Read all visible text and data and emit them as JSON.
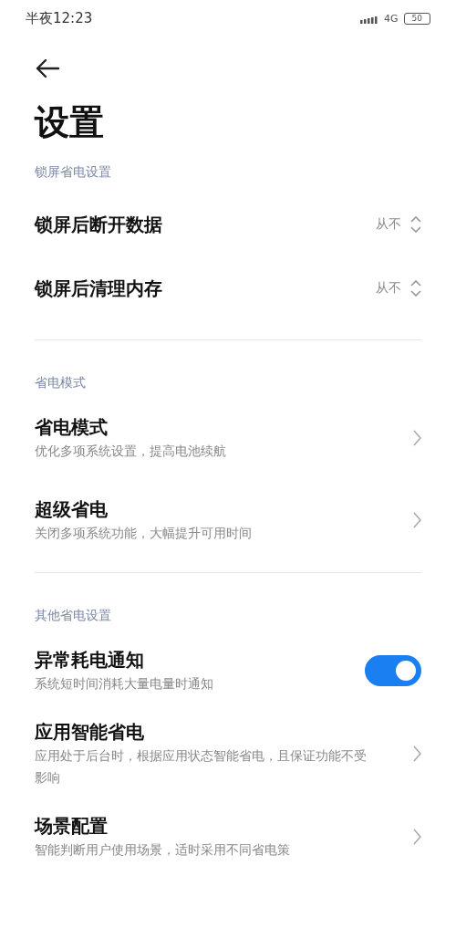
{
  "status_bar": {
    "time": "半夜12:23",
    "network": "4G",
    "battery": "50"
  },
  "title": "设置",
  "sections": [
    {
      "title": "锁屏省电设置",
      "items": [
        {
          "kind": "select",
          "label": "锁屏后断开数据",
          "value": "从不"
        },
        {
          "kind": "select",
          "label": "锁屏后清理内存",
          "value": "从不"
        }
      ]
    },
    {
      "title": "省电模式",
      "items": [
        {
          "kind": "nav",
          "label": "省电模式",
          "description": "优化多项系统设置，提高电池续航"
        },
        {
          "kind": "nav",
          "label": "超级省电",
          "description": "关闭多项系统功能，大幅提升可用时间"
        }
      ]
    },
    {
      "title": "其他省电设置",
      "items": [
        {
          "kind": "toggle",
          "label": "异常耗电通知",
          "description": "系统短时间消耗大量电量时通知",
          "on": true
        },
        {
          "kind": "nav",
          "label": "应用智能省电",
          "description": "应用处于后台时，根据应用状态智能省电，且保证功能不受影响"
        },
        {
          "kind": "nav",
          "label": "场景配置",
          "description": "智能判断用户使用场景，适时采用不同省电策"
        }
      ]
    }
  ]
}
